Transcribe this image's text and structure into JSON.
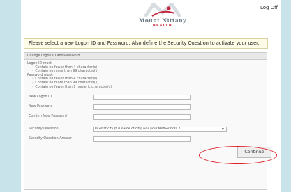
{
  "header": {
    "logo_text": "Mount Nittany",
    "logo_sub": "HEALTH",
    "logoff_label": "Log Off"
  },
  "notice": "Please select a new Logon ID and Password. Also define the Security Question to activate your user.",
  "panel": {
    "title": "Change Logon ID and Password",
    "rules": {
      "logon_heading": "Logon ID must:",
      "logon_min": "• Contain no fewer than 4 character(s)",
      "logon_max": "• Contain no more than 99 character(s)",
      "password_heading": "Password must:",
      "password_min": "• Contain no fewer than 4 character(s)",
      "password_max": "• Contain no more than 99 character(s)",
      "password_numeric": "• Contain no fewer than 1 numeric character(s)"
    },
    "fields": {
      "new_logon_label": "New Logon ID",
      "new_logon_value": "",
      "new_password_label": "New Password",
      "new_password_value": "",
      "confirm_password_label": "Confirm New Password",
      "confirm_password_value": "",
      "security_question_label": "Security Question",
      "security_question_value": "In what city (full name of city) was your Mother born ?",
      "security_answer_label": "Security Question Answer",
      "security_answer_value": ""
    },
    "continue_label": "Continue"
  },
  "colors": {
    "background": "#c8e4ea",
    "notice_bg": "#fefce6",
    "highlight_circle": "#e0222a",
    "brand_red": "#c2273f"
  }
}
